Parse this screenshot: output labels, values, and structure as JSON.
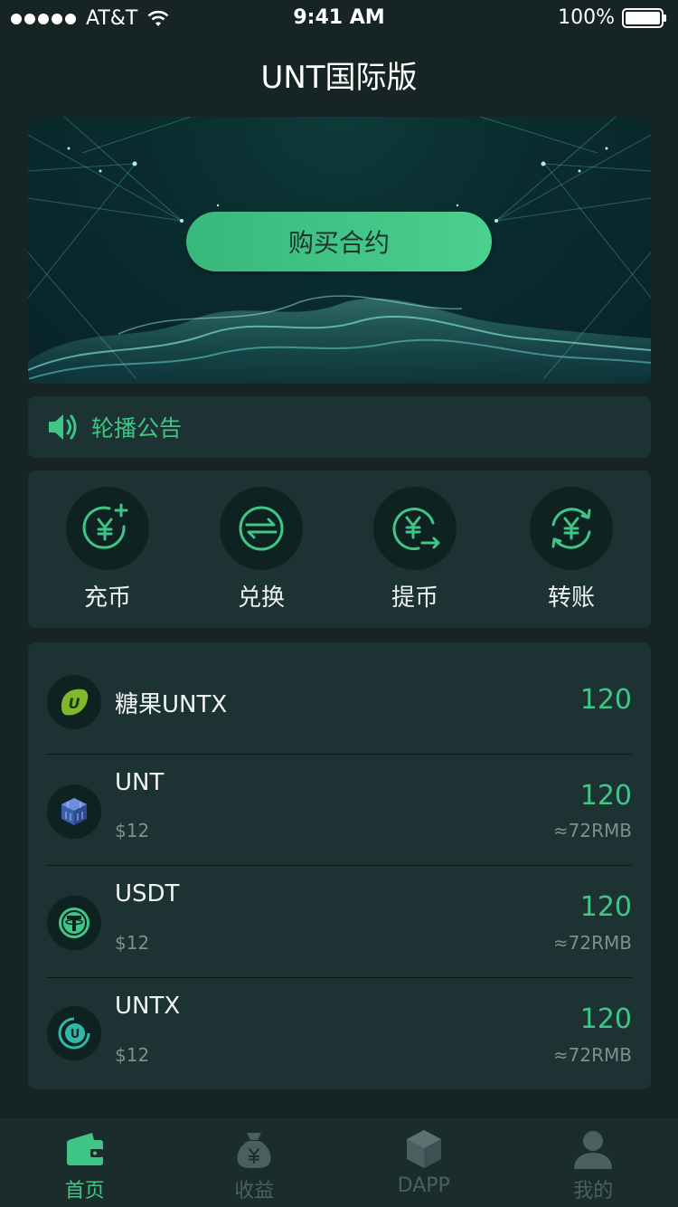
{
  "status_bar": {
    "carrier": "AT&T",
    "time": "9:41 AM",
    "battery": "100%"
  },
  "header": {
    "title": "UNT国际版"
  },
  "banner": {
    "button_label": "购买合约"
  },
  "notice": {
    "text": "轮播公告"
  },
  "actions": [
    {
      "label": "充币",
      "icon": "recharge-yuan-icon"
    },
    {
      "label": "兑换",
      "icon": "exchange-icon"
    },
    {
      "label": "提币",
      "icon": "withdraw-yuan-icon"
    },
    {
      "label": "转账",
      "icon": "transfer-yuan-icon"
    }
  ],
  "assets": [
    {
      "name": "糖果UNTX",
      "amount": "120",
      "icon": "candy-untx-logo-icon"
    },
    {
      "name": "UNT",
      "price": "$12",
      "amount": "120",
      "rmb": "≈72RMB",
      "icon": "unt-cube-logo-icon"
    },
    {
      "name": "USDT",
      "price": "$12",
      "amount": "120",
      "rmb": "≈72RMB",
      "icon": "usdt-tether-logo-icon"
    },
    {
      "name": "UNTX",
      "price": "$12",
      "amount": "120",
      "rmb": "≈72RMB",
      "icon": "untx-logo-icon"
    }
  ],
  "tabs": [
    {
      "label": "首页",
      "icon": "wallet-icon",
      "active": true
    },
    {
      "label": "收益",
      "icon": "money-bag-icon",
      "active": false
    },
    {
      "label": "DAPP",
      "icon": "cube-icon",
      "active": false
    },
    {
      "label": "我的",
      "icon": "user-icon",
      "active": false
    }
  ],
  "colors": {
    "accent": "#3fc686",
    "background": "#172424",
    "card": "#1d3233",
    "inactive_tab": "#4a6060"
  }
}
